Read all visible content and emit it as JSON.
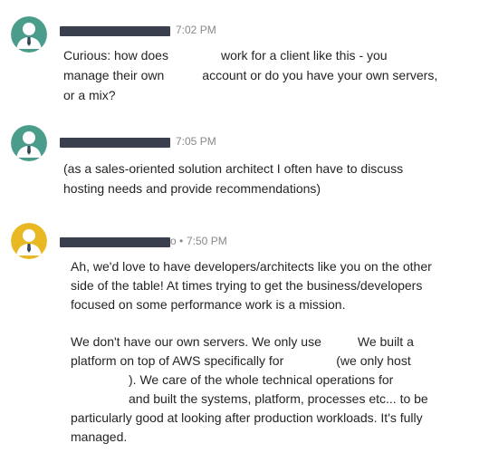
{
  "messages": [
    {
      "avatar_color": "#4a9d8a",
      "avatar_icon": "person-icon",
      "time": "7:02 PM",
      "segments": {
        "s1": "Curious: how does",
        "s2": "work for a client like this - you",
        "s3": "manage their own",
        "s4": "account or do you have your own servers,",
        "s5": "or a mix?"
      }
    },
    {
      "avatar_color": "#4a9d8a",
      "avatar_icon": "person-icon",
      "time": "7:05 PM",
      "segments": {
        "s1": "(as a sales-oriented solution architect I often have to discuss",
        "s2": "hosting needs and provide recommendations)"
      }
    },
    {
      "avatar_color": "#e8b923",
      "avatar_icon": "person-icon",
      "time": "7:50 PM",
      "time_prefix": "o •",
      "segments": {
        "s1": "Ah, we'd love to have developers/architects like you on the other",
        "s2": "side of the table! At times trying to get the business/developers",
        "s3": "focused on some performance work is a mission.",
        "s4": "We don't have our own servers. We only use",
        "s5": "We built a",
        "s6": "platform on top of AWS specifically for",
        "s7": "(we only host",
        "s8": "). We care of the whole technical operations for",
        "s9": "and built the systems, platform, processes etc... to be",
        "s10": "particularly good at looking after production workloads. It's fully",
        "s11": "managed."
      }
    }
  ]
}
